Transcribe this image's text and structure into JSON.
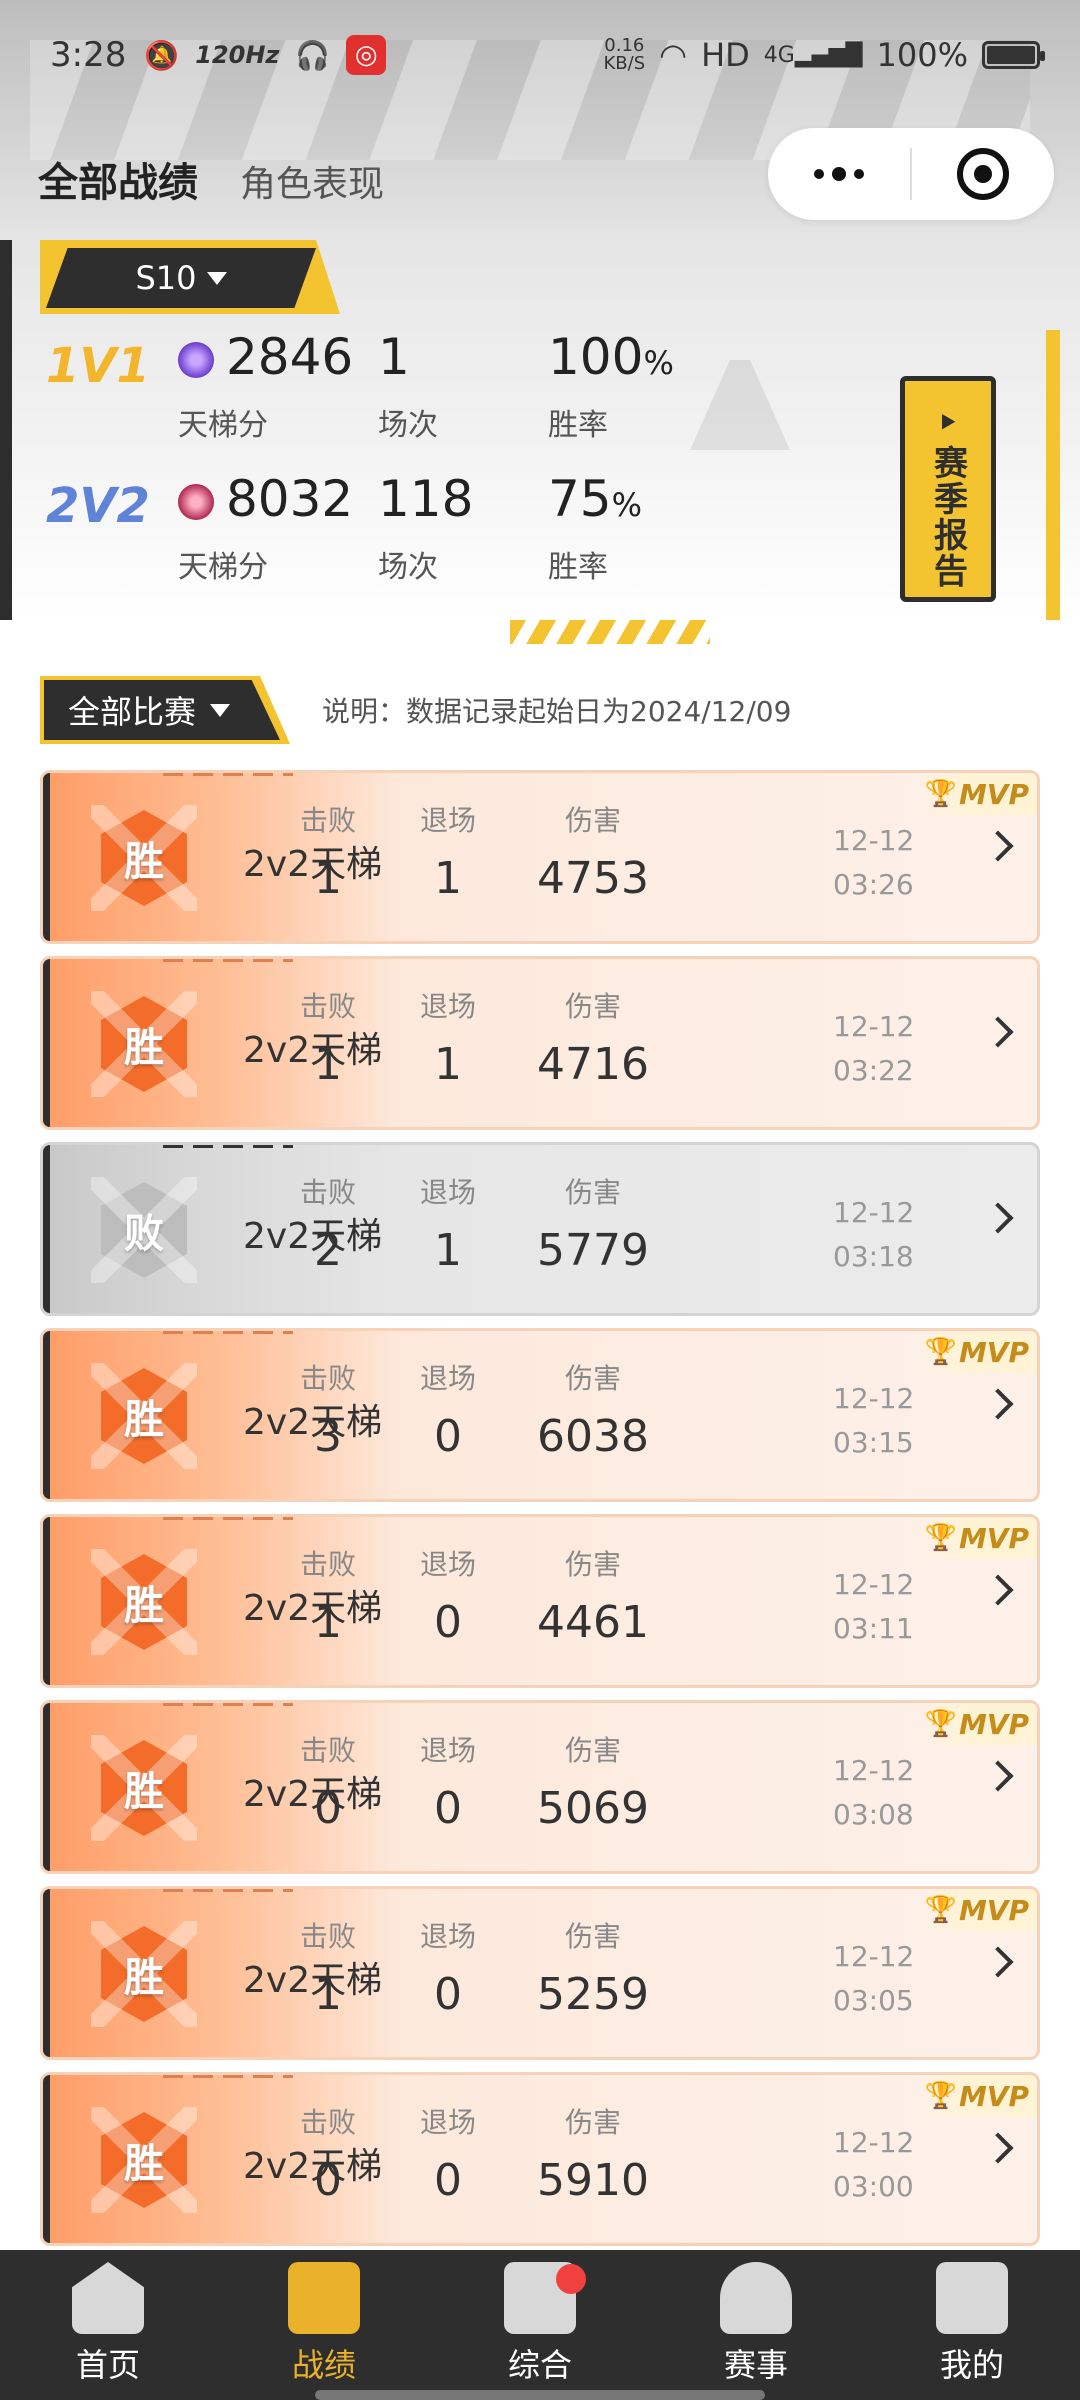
{
  "status_bar": {
    "time": "3:28",
    "refresh": "120Hz",
    "speed_top": "0.16",
    "speed_bottom": "KB/S",
    "hd": "HD",
    "net": "4G",
    "battery": "100%"
  },
  "tabs": {
    "active": "全部战绩",
    "inactive": "角色表现"
  },
  "season": {
    "label": "S10"
  },
  "modes": [
    {
      "name": "1V1",
      "rating": "2846",
      "rating_label": "天梯分",
      "matches": "1",
      "matches_label": "场次",
      "winrate": "100",
      "winrate_unit": "%",
      "winrate_label": "胜率"
    },
    {
      "name": "2V2",
      "rating": "8032",
      "rating_label": "天梯分",
      "matches": "118",
      "matches_label": "场次",
      "winrate": "75",
      "winrate_unit": "%",
      "winrate_label": "胜率"
    }
  ],
  "report_button": {
    "label": "赛季报告"
  },
  "filter": {
    "label": "全部比赛"
  },
  "note": "说明：数据记录起始日为2024/12/09",
  "col_headers": {
    "kills": "击败",
    "exits": "退场",
    "damage": "伤害"
  },
  "matches": [
    {
      "result": "胜",
      "mode": "2v2天梯",
      "kills": "1",
      "exits": "1",
      "damage": "4753",
      "date": "12-12",
      "time": "03:26",
      "mvp": "MVP"
    },
    {
      "result": "胜",
      "mode": "2v2天梯",
      "kills": "1",
      "exits": "1",
      "damage": "4716",
      "date": "12-12",
      "time": "03:22",
      "mvp": ""
    },
    {
      "result": "败",
      "mode": "2v2天梯",
      "kills": "2",
      "exits": "1",
      "damage": "5779",
      "date": "12-12",
      "time": "03:18",
      "mvp": ""
    },
    {
      "result": "胜",
      "mode": "2v2天梯",
      "kills": "3",
      "exits": "0",
      "damage": "6038",
      "date": "12-12",
      "time": "03:15",
      "mvp": "MVP"
    },
    {
      "result": "胜",
      "mode": "2v2天梯",
      "kills": "1",
      "exits": "0",
      "damage": "4461",
      "date": "12-12",
      "time": "03:11",
      "mvp": "MVP"
    },
    {
      "result": "胜",
      "mode": "2v2天梯",
      "kills": "0",
      "exits": "0",
      "damage": "5069",
      "date": "12-12",
      "time": "03:08",
      "mvp": "MVP"
    },
    {
      "result": "胜",
      "mode": "2v2天梯",
      "kills": "1",
      "exits": "0",
      "damage": "5259",
      "date": "12-12",
      "time": "03:05",
      "mvp": "MVP"
    },
    {
      "result": "胜",
      "mode": "2v2天梯",
      "kills": "0",
      "exits": "0",
      "damage": "5910",
      "date": "12-12",
      "time": "03:00",
      "mvp": "MVP"
    }
  ],
  "nav": [
    {
      "label": "首页",
      "icon": "home-icon"
    },
    {
      "label": "战绩",
      "icon": "crossed-swords-icon"
    },
    {
      "label": "综合",
      "icon": "newspaper-icon"
    },
    {
      "label": "赛事",
      "icon": "trophy-icon"
    },
    {
      "label": "我的",
      "icon": "profile-card-icon"
    }
  ],
  "colors": {
    "accent": "#f3c330",
    "win": "#f36c2a",
    "nav_bg": "#2e2e2e"
  }
}
